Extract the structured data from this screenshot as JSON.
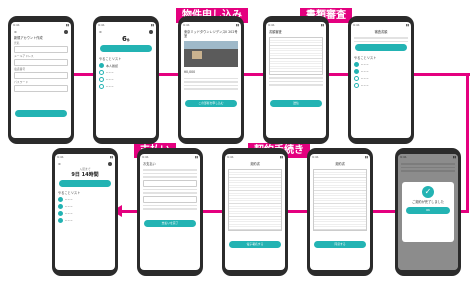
{
  "labels": {
    "property_application": "物件申し込み",
    "document_review": "書類審査",
    "payment": "支払い",
    "contract": "契約手続き"
  },
  "phones": {
    "p1": {
      "title": "新規アカウント作成",
      "button": ""
    },
    "p2": {
      "number": "6",
      "number_unit": "件",
      "todo": "やることリスト",
      "button": ""
    },
    "p3": {
      "title": "東京ミッドタウンレジデンスII 202号室",
      "price": "¥0,000",
      "button": "この部屋を申し込む"
    },
    "p4": {
      "title": "書類審査",
      "button": "送信"
    },
    "p5": {
      "title": "審査書類",
      "todo": "やることリスト"
    },
    "p6": {
      "remaining": "9日 14時間",
      "todo": "やることリスト"
    },
    "p7": {
      "title": "お支払い",
      "button": "支払いを完了"
    },
    "p8": {
      "title": "契約書",
      "button": "電子署名する"
    },
    "p9": {
      "title": "契約書",
      "button": "同意する"
    },
    "p10": {
      "title": "ご契約が完了しました",
      "button": "OK"
    }
  },
  "colors": {
    "accent": "#e4007f",
    "teal": "#23b3b3",
    "phone": "#2b2b2b"
  }
}
